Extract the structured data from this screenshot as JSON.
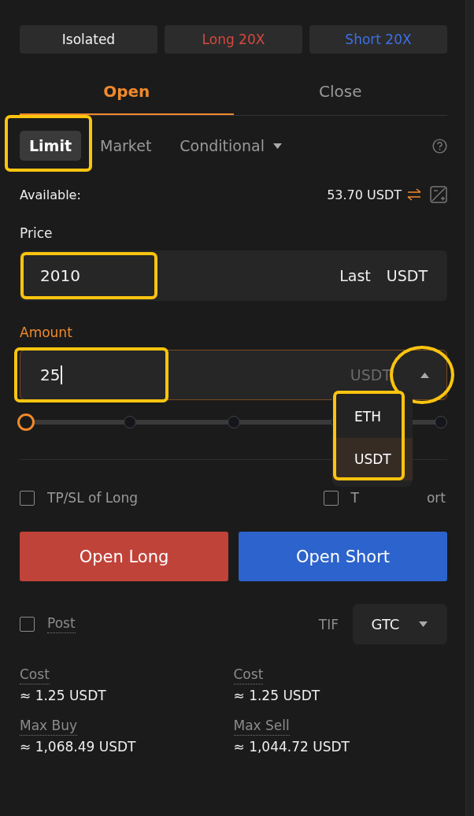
{
  "mode_buttons": [
    {
      "label": "Isolated",
      "kind": "neutral"
    },
    {
      "label": "Long 20X",
      "kind": "long"
    },
    {
      "label": "Short 20X",
      "kind": "short"
    }
  ],
  "side_tabs": [
    {
      "label": "Open",
      "selected": true
    },
    {
      "label": "Close",
      "selected": false
    }
  ],
  "order_types": [
    {
      "label": "Limit",
      "selected": true,
      "highlighted": true,
      "dropdown": false
    },
    {
      "label": "Market",
      "selected": false,
      "highlighted": false,
      "dropdown": false
    },
    {
      "label": "Conditional",
      "selected": false,
      "highlighted": false,
      "dropdown": true
    }
  ],
  "available": {
    "label": "Available:",
    "value": "53.70 USDT"
  },
  "price": {
    "label": "Price",
    "value": "2010",
    "highlighted": true,
    "mode": "Last",
    "unit": "USDT"
  },
  "amount": {
    "label": "Amount",
    "value": "25",
    "highlighted": true,
    "unit": "USDT",
    "unit_menu_open": true,
    "toggle_highlighted": true
  },
  "unit_menu": {
    "highlighted": true,
    "items": [
      {
        "label": "ETH",
        "selected": false
      },
      {
        "label": "USDT",
        "selected": true
      }
    ]
  },
  "slider": {
    "level": 0
  },
  "tpsl": [
    {
      "label": "TP/SL of Long",
      "checked": false
    },
    {
      "label": "T",
      "label_tail": "ort",
      "checked": false
    }
  ],
  "actions": [
    {
      "label": "Open Long",
      "kind": "long"
    },
    {
      "label": "Open Short",
      "kind": "short"
    }
  ],
  "post": {
    "label": "Post",
    "checked": false
  },
  "tif": {
    "label": "TIF",
    "value": "GTC"
  },
  "summary": [
    {
      "label": "Cost",
      "value": "≈ 1.25 USDT"
    },
    {
      "label": "Cost",
      "value": "≈ 1.25 USDT"
    },
    {
      "label": "Max Buy",
      "value": "≈ 1,068.49 USDT"
    },
    {
      "label": "Max Sell",
      "value": "≈ 1,044.72 USDT"
    }
  ]
}
